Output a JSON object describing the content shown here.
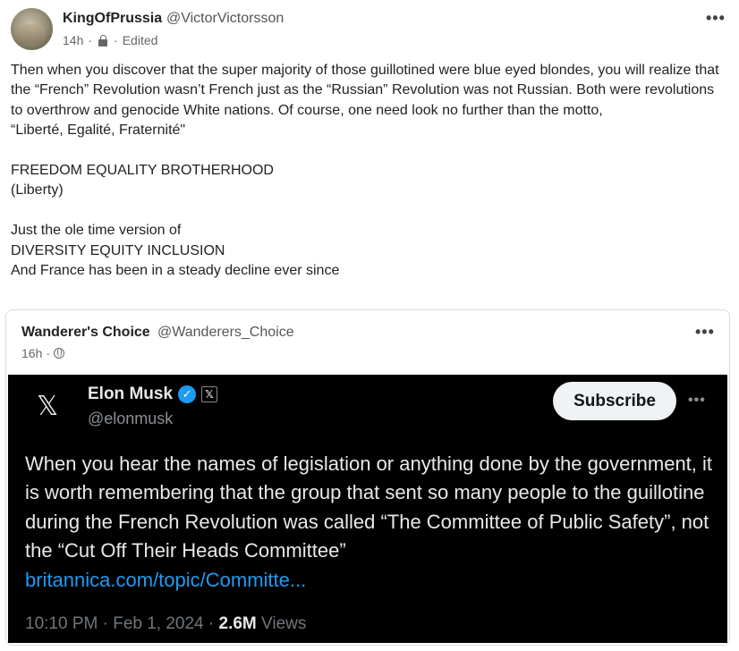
{
  "post": {
    "author_name": "KingOfPrussia",
    "author_handle": "@VictorVictorsson",
    "time": "14h",
    "dot": "·",
    "edited": "Edited",
    "more": "•••",
    "text": "Then when you discover that the super majority of those guillotined were blue eyed blondes, you will realize that the “French” Revolution wasn’t French just as the “Russian” Revolution was not Russian. Both were revolutions to overthrow and genocide White nations. Of course, one need look no further than the motto,\n“Liberté, Egalité, Fraternité\"\n\nFREEDOM EQUALITY BROTHERHOOD\n(Liberty)\n\nJust the ole time version of\nDIVERSITY EQUITY INCLUSION\nAnd France has been in a steady decline ever since"
  },
  "quote": {
    "author_name": "Wanderer's Choice",
    "author_handle": "@Wanderers_Choice",
    "time": "16h",
    "dot": "·",
    "more": "•••",
    "screenshot": {
      "x_logo": "𝕏",
      "name": "Elon Musk",
      "verified": "✓",
      "badge": "𝕏",
      "handle": "@elonmusk",
      "subscribe": "Subscribe",
      "more": "•••",
      "text": "When you hear the names of legislation or anything done by the government, it is worth remembering that the group that sent so many people to the guillotine during the French Revolution was called “The Committee of Public Safety”, not the “Cut Off Their Heads Committee”",
      "link": "britannica.com/topic/Committe...",
      "timestamp": "10:10 PM · Feb 1, 2024 · ",
      "views_count": "2.6M",
      "views_label": " Views"
    }
  }
}
